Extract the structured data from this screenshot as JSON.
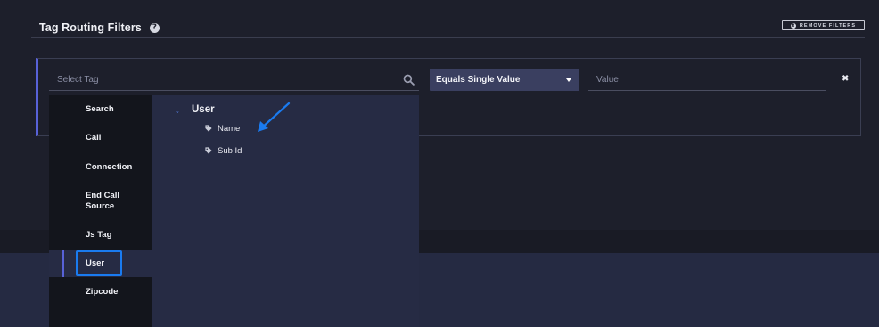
{
  "header": {
    "title": "Tag Routing Filters",
    "help_icon": "?",
    "remove_filters_label": "REMOVE FILTERS",
    "remove_filters_icon": "✖"
  },
  "filter": {
    "select_tag_placeholder": "Select Tag",
    "operator_value": "Equals Single Value",
    "value_placeholder": "Value",
    "close_icon": "✖"
  },
  "dropdown": {
    "categories": [
      {
        "label": "Search"
      },
      {
        "label": "Call"
      },
      {
        "label": "Connection"
      },
      {
        "label": "End Call Source"
      },
      {
        "label": "Js Tag"
      },
      {
        "label": "User"
      },
      {
        "label": "Zipcode"
      }
    ],
    "selected_category": "User",
    "group": {
      "caret": "⌄",
      "label": "User",
      "items": [
        {
          "label": "Name"
        },
        {
          "label": "Sub Id"
        }
      ]
    }
  },
  "colors": {
    "background": "#1d1f2b",
    "accent": "#5862d8",
    "highlight": "#1a7bf0",
    "dropdown_dark": "#13151c",
    "dropdown_panel": "#262b44"
  }
}
